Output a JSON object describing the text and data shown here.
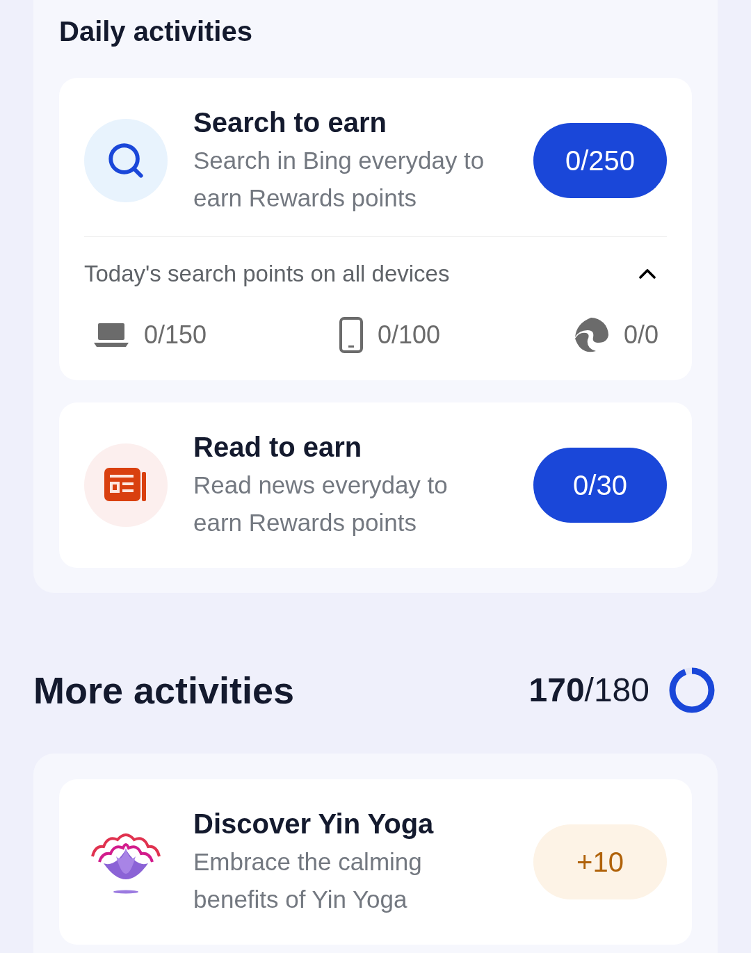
{
  "daily": {
    "title": "Daily activities",
    "cards": [
      {
        "kind": "search",
        "title": "Search to earn",
        "description": "Search in Bing everyday to earn Rewards points",
        "points": {
          "text": "0/250",
          "kind": "progress"
        },
        "devices": {
          "label": "Today's search points on all devices",
          "expanded": true,
          "items": [
            {
              "kind": "laptop",
              "value": "0/150"
            },
            {
              "kind": "phone",
              "value": "0/100"
            },
            {
              "kind": "browser",
              "value": "0/0"
            }
          ]
        }
      },
      {
        "kind": "news",
        "title": "Read to earn",
        "description": "Read news everyday to earn Rewards points",
        "points": {
          "text": "0/30",
          "kind": "progress"
        }
      }
    ]
  },
  "more": {
    "title": "More activities",
    "progress": "**170**/180",
    "level": 0.944,
    "cards": [
      {
        "kind": "yoga",
        "title": "Discover Yin Yoga",
        "description": "Embrace the calming benefits of Yin Yoga",
        "points": {
          "text": "+10",
          "kind": "bonus"
        }
      }
    ]
  }
}
